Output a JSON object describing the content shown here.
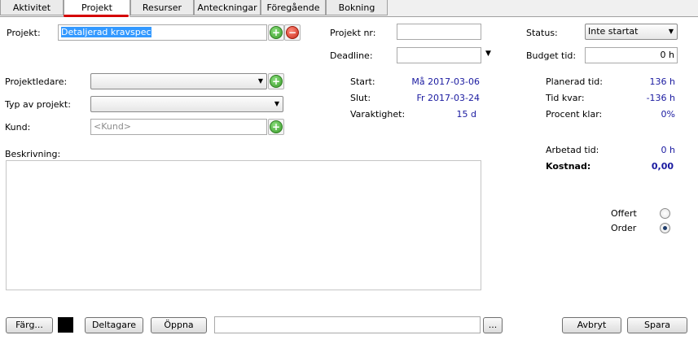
{
  "tabs": [
    {
      "label": "Aktivitet",
      "active": false
    },
    {
      "label": "Projekt",
      "active": true
    },
    {
      "label": "Resurser",
      "active": false
    },
    {
      "label": "Anteckningar",
      "active": false
    },
    {
      "label": "Föregående",
      "active": false
    },
    {
      "label": "Bokning",
      "active": false
    }
  ],
  "form": {
    "projekt_label": "Projekt:",
    "projekt_value": "Detaljerad kravspec",
    "projektnr_label": "Projekt nr:",
    "projektnr_value": "",
    "deadline_label": "Deadline:",
    "deadline_value": "",
    "status_label": "Status:",
    "status_value": "Inte startat",
    "budget_label": "Budget tid:",
    "budget_value": "0 h",
    "projektledare_label": "Projektledare:",
    "typ_label": "Typ av projekt:",
    "kund_label": "Kund:",
    "kund_placeholder": "<Kund>",
    "beskrivning_label": "Beskrivning:"
  },
  "dates": {
    "start_label": "Start:",
    "start_value": "Må 2017-03-06",
    "slut_label": "Slut:",
    "slut_value": "Fr 2017-03-24",
    "varaktighet_label": "Varaktighet:",
    "varaktighet_value": "15 d"
  },
  "stats": {
    "planerad_label": "Planerad tid:",
    "planerad_value": "136 h",
    "kvar_label": "Tid kvar:",
    "kvar_value": "-136 h",
    "procent_label": "Procent klar:",
    "procent_value": "0%",
    "arbetad_label": "Arbetad tid:",
    "arbetad_value": "0 h",
    "kostnad_label": "Kostnad:",
    "kostnad_value": "0,00"
  },
  "type_radio": {
    "offert_label": "Offert",
    "order_label": "Order",
    "selected": "Order"
  },
  "bottom": {
    "farg_label": "Färg...",
    "color": "#000000",
    "deltagare_label": "Deltagare",
    "oppna_label": "Öppna",
    "path_value": "",
    "browse_label": "...",
    "avbryt_label": "Avbryt",
    "spara_label": "Spara"
  },
  "colors": {
    "value_blue": "#1a1aa0",
    "tab_accent": "#d40000",
    "selection": "#3399ff"
  }
}
